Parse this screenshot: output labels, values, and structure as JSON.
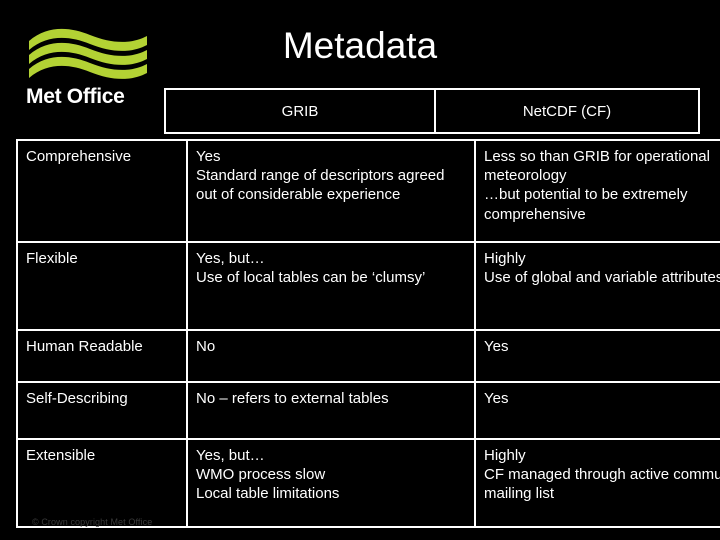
{
  "brand": {
    "wordmark": "Met Office",
    "logo_color": "#b3d234",
    "logo_icon": "wave-bands-logo"
  },
  "slide": {
    "title": "Metadata",
    "background_color": "#000000",
    "text_color": "#ffffff"
  },
  "table": {
    "headers": [
      "",
      "GRIB",
      "NetCDF (CF)"
    ],
    "rows": [
      {
        "label": "Comprehensive",
        "grib": [
          "Yes",
          "Standard range of descriptors agreed out of considerable experience"
        ],
        "netcdf": [
          "Less so than GRIB for operational meteorology",
          "…but potential to be extremely comprehensive"
        ]
      },
      {
        "label": "Flexible",
        "grib": [
          "Yes, but…",
          "Use of local tables can be ‘clumsy’"
        ],
        "netcdf": [
          "Highly",
          "Use of global and variable attributes"
        ]
      },
      {
        "label": "Human Readable",
        "grib": [
          "No"
        ],
        "netcdf": [
          "Yes"
        ]
      },
      {
        "label": "Self-Describing",
        "grib": [
          "No – refers to external tables"
        ],
        "netcdf": [
          "Yes"
        ]
      },
      {
        "label": "Extensible",
        "grib": [
          "Yes, but…",
          "WMO process slow",
          "Local table limitations"
        ],
        "netcdf": [
          "Highly",
          "CF managed through active community mailing list"
        ]
      }
    ]
  },
  "footer": {
    "copyright": "© Crown copyright   Met Office"
  }
}
